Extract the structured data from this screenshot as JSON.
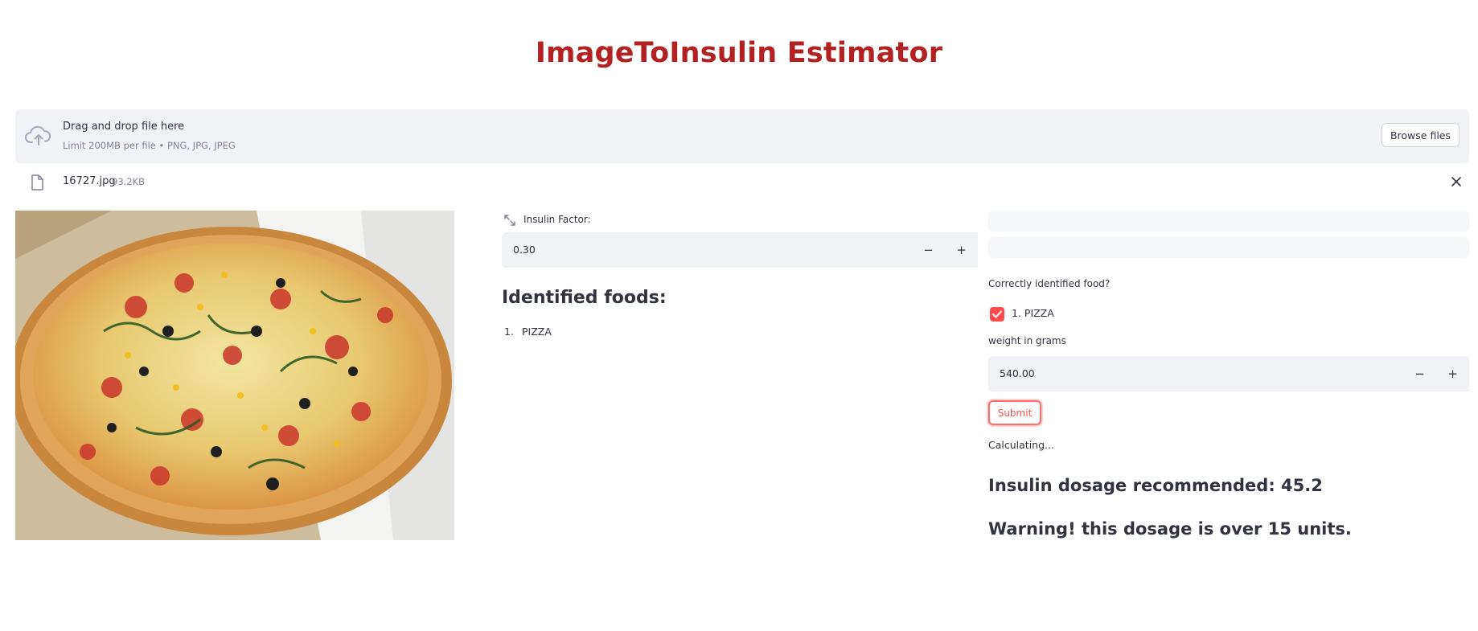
{
  "app": {
    "title": "ImageToInsulin Estimator",
    "accent_color": "#b22222",
    "primary_color": "#ff4b4b"
  },
  "uploader": {
    "icon": "cloud-upload-icon",
    "main_text": "Drag and drop file here",
    "sub_text": "Limit 200MB per file • PNG, JPG, JPEG",
    "browse_label": "Browse files"
  },
  "file": {
    "icon": "file-icon",
    "name": "16727.jpg",
    "size": "93.2KB",
    "close_icon": "close-icon"
  },
  "image": {
    "subject": "pizza"
  },
  "insulin_factor": {
    "label": "Insulin Factor:",
    "value": "0.30",
    "minus": "−",
    "plus": "+"
  },
  "identified": {
    "title": "Identified foods:",
    "items": [
      {
        "num": "1.",
        "label": "PIZZA"
      }
    ]
  },
  "confirm": {
    "question": "Correctly identified food?",
    "items": [
      {
        "label": "1. PIZZA",
        "checked": true
      }
    ]
  },
  "weight": {
    "label": "weight in grams",
    "value": "540.00",
    "minus": "−",
    "plus": "+"
  },
  "submit_label": "Submit",
  "status": "Calculating...",
  "result": {
    "dosage": "Insulin dosage recommended: 45.2",
    "warning": "Warning! this dosage is over 15 units."
  }
}
